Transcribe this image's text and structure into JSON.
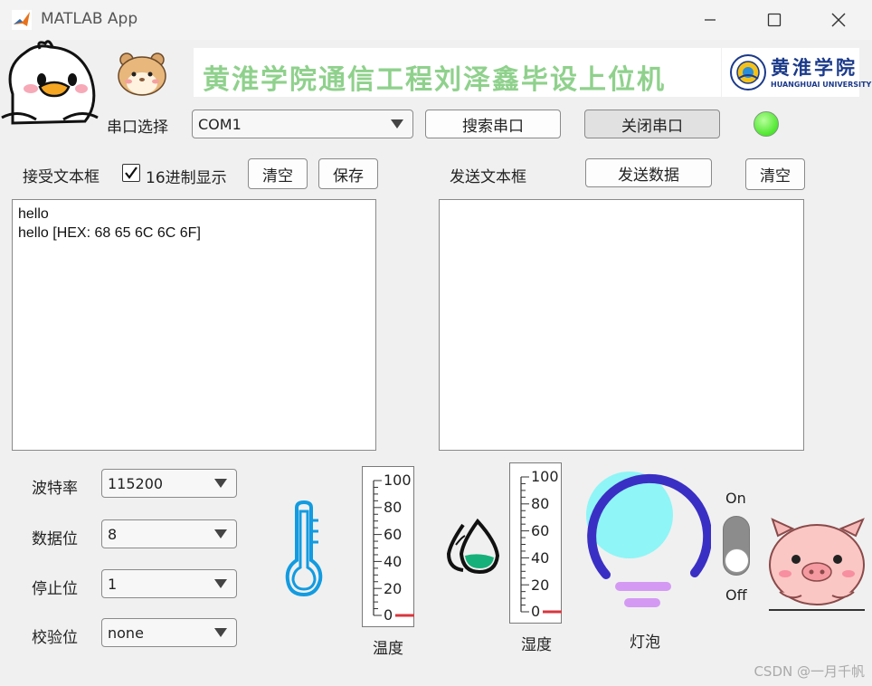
{
  "window": {
    "title": "MATLAB App",
    "minimize_icon": "minimize-icon",
    "maximize_icon": "maximize-icon",
    "close_icon": "close-icon"
  },
  "banner": {
    "text": "黄淮学院通信工程刘泽鑫毕设上位机",
    "university_cn": "黄淮学院",
    "university_en": "HUANGHUAI UNIVERSITY"
  },
  "serial": {
    "label": "串口选择",
    "port_value": "COM1",
    "search_label": "搜索串口",
    "close_label": "关闭串口",
    "status_color": "#22dd00"
  },
  "receive": {
    "label": "接受文本框",
    "hex_checkbox_label": "16进制显示",
    "hex_checked": true,
    "clear_label": "清空",
    "save_label": "保存",
    "lines": [
      "hello",
      "hello [HEX: 68 65 6C 6C 6F]"
    ]
  },
  "send": {
    "label": "发送文本框",
    "send_label": "发送数据",
    "clear_label": "清空",
    "content": ""
  },
  "settings": {
    "baud_label": "波特率",
    "baud_value": "115200",
    "data_bits_label": "数据位",
    "data_bits_value": "8",
    "stop_bits_label": "停止位",
    "stop_bits_value": "1",
    "parity_label": "校验位",
    "parity_value": "none"
  },
  "temperature": {
    "label": "温度",
    "icon": "thermometer-icon",
    "ticks": [
      "100",
      "80",
      "60",
      "40",
      "20",
      "0"
    ],
    "value": 0
  },
  "humidity": {
    "label": "湿度",
    "icon": "water-drop-icon",
    "ticks": [
      "100",
      "80",
      "60",
      "40",
      "20",
      "0"
    ],
    "value": 0
  },
  "lamp": {
    "label": "灯泡",
    "icon": "lightbulb-icon",
    "switch_on_label": "On",
    "switch_off_label": "Off",
    "switch_state": "off",
    "lamp_color": "#8ff5f7",
    "ring_color": "#3a2fc4",
    "base_color": "#d49af3"
  },
  "footer": {
    "watermark": "CSDN @一月千帆"
  }
}
